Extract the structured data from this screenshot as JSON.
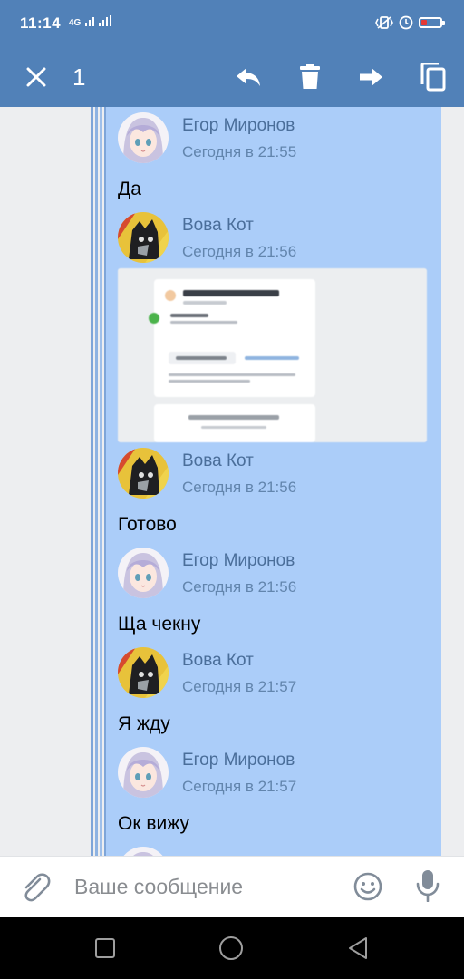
{
  "status": {
    "time": "11:14",
    "network": "4G"
  },
  "toolbar": {
    "selected_count": "1"
  },
  "messages": [
    {
      "name": "Егор Миронов",
      "time": "Сегодня в 21:55",
      "text": "Да"
    },
    {
      "name": "Вова Кот",
      "time": "Сегодня в 21:56"
    },
    {
      "name": "Вова Кот",
      "time": "Сегодня в 21:56",
      "text": "Готово"
    },
    {
      "name": "Егор Миронов",
      "time": "Сегодня в 21:56",
      "text": "Ща чекну"
    },
    {
      "name": "Вова Кот",
      "time": "Сегодня в 21:57",
      "text": "Я жду"
    },
    {
      "name": "Егор Миронов",
      "time": "Сегодня в 21:57",
      "text": "Ок вижу"
    }
  ],
  "composer": {
    "placeholder": "Ваше сообщение"
  },
  "icons": {
    "close": "close-icon",
    "reply": "reply-icon",
    "delete": "trash-icon",
    "forward": "forward-icon",
    "copy": "copy-icon",
    "attach": "paperclip-icon",
    "emoji": "smile-icon",
    "mic": "microphone-icon",
    "nav_recent": "square-icon",
    "nav_home": "circle-icon",
    "nav_back": "triangle-back-icon"
  },
  "colors": {
    "header": "#5181b8",
    "selection": "#abcdf9",
    "name_text": "#4a6e9a"
  }
}
